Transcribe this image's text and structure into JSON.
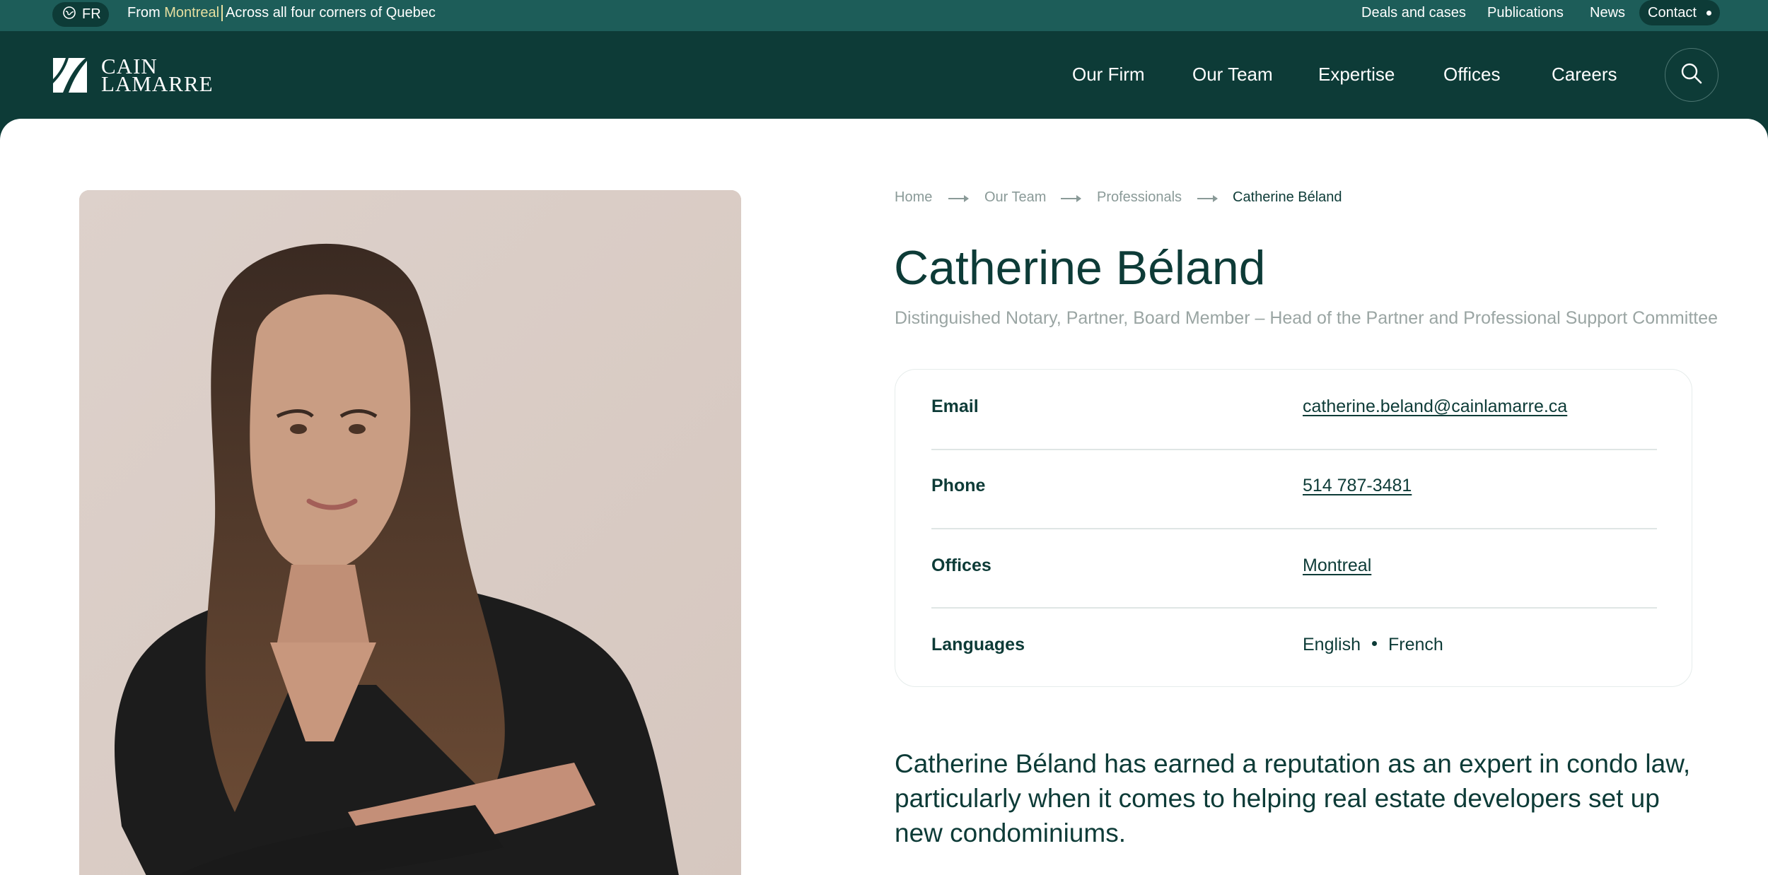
{
  "topbar": {
    "lang_label": "FR",
    "tagline_prefix": "From",
    "tagline_city": "Montreal",
    "tagline_suffix": "Across all four corners of Quebec",
    "links": [
      "Deals and cases",
      "Publications",
      "News"
    ],
    "contact_label": "Contact"
  },
  "header": {
    "logo_line1": "CAIN",
    "logo_line2": "LAMARRE",
    "nav": [
      "Our Firm",
      "Our Team",
      "Expertise",
      "Offices",
      "Careers"
    ]
  },
  "breadcrumb": [
    "Home",
    "Our Team",
    "Professionals",
    "Catherine Béland"
  ],
  "profile": {
    "name": "Catherine Béland",
    "title": "Distinguished Notary, Partner, Board Member – Head of the Partner and Professional Support Committee",
    "email_label": "Email",
    "email": "catherine.beland@cainlamarre.ca",
    "phone_label": "Phone",
    "phone": "514 787-3481",
    "offices_label": "Offices",
    "office": "Montreal",
    "languages_label": "Languages",
    "languages": [
      "English",
      "French"
    ],
    "bio": "Catherine Béland has earned a reputation as an expert in condo law, particularly when it comes to helping real estate developers set up new condominiums."
  },
  "colors": {
    "brand_dark": "#0d3b37",
    "brand_bar": "#1d5d59",
    "accent_city": "#e7dfa0",
    "muted_text": "#9aa5a3"
  }
}
